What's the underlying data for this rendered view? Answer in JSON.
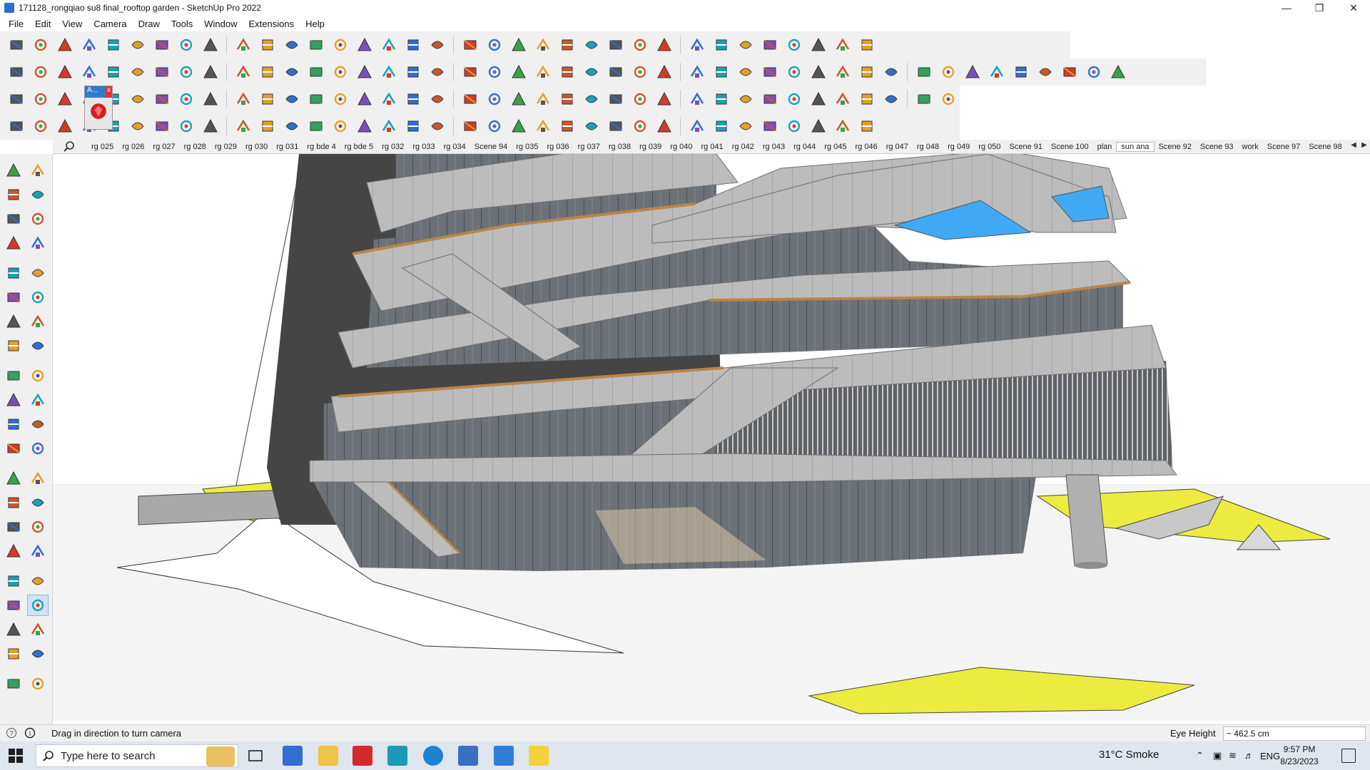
{
  "window": {
    "title": "171128_rongqiao su8 final_rooftop garden - SketchUp Pro 2022",
    "controls": [
      "minimize",
      "restore",
      "close"
    ]
  },
  "menu": [
    "File",
    "Edit",
    "View",
    "Camera",
    "Draw",
    "Tools",
    "Window",
    "Extensions",
    "Help"
  ],
  "toolbars": {
    "row1_icons": [
      "zoom-extents",
      "select",
      "eraser",
      "pencil-line",
      "arc",
      "rectangle",
      "push-pull",
      "follow-me",
      "move",
      "rotate",
      "scale",
      "tape-measure",
      "text",
      "paint-bucket",
      "orbit",
      "pan",
      "zoom",
      "zoom-window",
      "section-plane",
      "section-display",
      "section-fill",
      "section-cuts",
      "warehouse",
      "extension-warehouse",
      "layout",
      "send-to-layout",
      "style-builder",
      "tags",
      "arrows-up",
      "arrows-down",
      "dimension",
      "intersect",
      "undo",
      "redo",
      "solid-inspector"
    ],
    "row2_icons": [
      "component-1",
      "component-2",
      "component-3",
      "joint-push-pull",
      "push-up",
      "push-right",
      "push-green",
      "push-north",
      "push-orange",
      "push-pink",
      "follow-curve",
      "section-blue-1",
      "section-blue-2",
      "section-blue-3",
      "green-box",
      "green-box-2",
      "house-1",
      "house-2",
      "house-3",
      "house-4",
      "house-5",
      "house-6",
      "fx-chart",
      "leaf",
      "line-tool",
      "shape-1",
      "shape-2",
      "shape-3",
      "shape-4",
      "shape-5",
      "shape-6",
      "shape-7",
      "shape-8",
      "shape-9",
      "shape-10",
      "shape-11",
      "red-tool-1",
      "red-tool-2",
      "texture-1",
      "texture-2",
      "texture-3",
      "texture-4",
      "texture-5",
      "texture-6",
      "texture-7"
    ],
    "row3_icons": [
      "blue-sheet",
      "blue-sheet-2",
      "yellow-sheet",
      "texture-tool",
      "red-arrow",
      "shape-flat",
      "loop-orange",
      "red-square",
      "layers-stack",
      "card-plane",
      "wood-block",
      "chain-link",
      "dots-curve",
      "red-plus",
      "green-plus",
      "x-cross",
      "cone-tool",
      "water-drop",
      "warn-triangle",
      "arc-yellow",
      "lasso",
      "cube-rotate",
      "snap-cross",
      "box-red",
      "loop-red",
      "cube-green",
      "box-arrow",
      "box-arrow-2",
      "box-arrow-3",
      "red-diamond",
      "gear-box",
      "monitor",
      "grid-orange",
      "grid-orange-2",
      "grid-yellow",
      "x-red",
      "dotted-curve",
      "grid-nodes"
    ],
    "row4_icons": [
      "split-curve",
      "curve-nodes",
      "car",
      "soap",
      "leaf-2",
      "ribbon",
      "bowl",
      "shield-swirl",
      "arrow-bend",
      "rail-1",
      "rail-2",
      "dash-red",
      "red-curve",
      "triangle-flat",
      "ice-cube",
      "bars-1",
      "bars-2",
      "hand-1",
      "arch",
      "bars-3",
      "layers-2",
      "arrow-d",
      "frame-1",
      "frame-2",
      "frame-3",
      "stairs",
      "stairs-2",
      "building",
      "spiral",
      "cube-hatch",
      "stack-hatch",
      "ramp",
      "ramp-2",
      "bird",
      "diamond-outline"
    ],
    "floating_tag": "A..."
  },
  "scenes": {
    "tabs": [
      "rg 025",
      "rg 026",
      "rg 027",
      "rg 028",
      "rg 029",
      "rg 030",
      "rg 031",
      "rg bde 4",
      "rg bde 5",
      "rg 032",
      "rg 033",
      "rg 034",
      "Scene 94",
      "rg 035",
      "rg 036",
      "rg 037",
      "rg 038",
      "rg 039",
      "rg 040",
      "rg 041",
      "rg 042",
      "rg 043",
      "rg 044",
      "rg 045",
      "rg 046",
      "rg 047",
      "rg 048",
      "rg 049",
      "rg 050",
      "Scene 91",
      "Scene 100",
      "plan",
      "sun ana",
      "Scene 92",
      "Scene 93",
      "work",
      "Scene 97",
      "Scene 98"
    ],
    "active": "sun ana"
  },
  "left_tools": [
    "select",
    "orbit",
    "paint",
    "eraser",
    "component",
    "tape",
    "pencil",
    "freehand",
    "rectangle",
    "rotated-rect",
    "circle",
    "polygon",
    "arc",
    "arc-2",
    "pie",
    "arc-3",
    "move",
    "push-pull",
    "rotate",
    "follow-me",
    "scale",
    "offset",
    "tape-measure",
    "dimension",
    "protractor",
    "text",
    "axes",
    "3d-text",
    "orbit-2",
    "pan",
    "zoom",
    "zoom-window",
    "zoom-extents",
    "previous",
    "position-camera",
    "look-around",
    "walk",
    "section-plane",
    "section-fill",
    "section-display",
    "section-cuts",
    "display-2"
  ],
  "status": {
    "message": "Drag in direction to turn camera",
    "vcb_label": "Eye Height",
    "vcb_value": "~ 462.5 cm"
  },
  "taskbar": {
    "search_placeholder": "Type here to search",
    "weather": "31°C  Smoke",
    "language": "ENG",
    "time": "9:57 PM",
    "date": "8/23/2023"
  },
  "colors": {
    "building_panel": "#b8b8b8",
    "glass": "#6a7076",
    "band_edge": "#b8864a",
    "ground_yellow": "#ecec40",
    "sky": "#3fa9f5"
  }
}
